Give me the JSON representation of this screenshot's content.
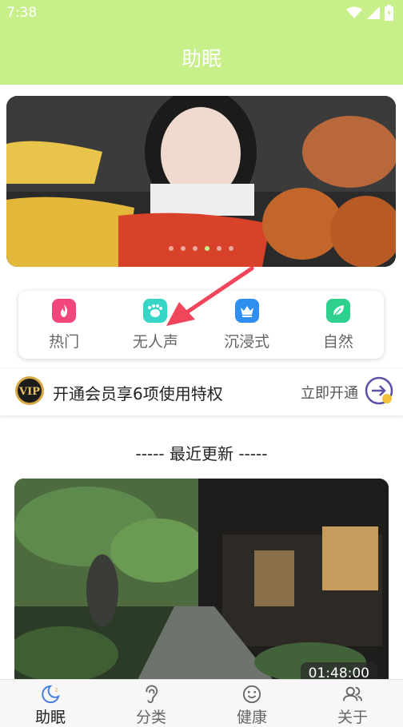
{
  "status": {
    "time": "7:38"
  },
  "app": {
    "title": "助眠"
  },
  "banner": {
    "dots": 6,
    "active_dot": 3
  },
  "categories": [
    {
      "label": "热门",
      "icon": "flame-icon",
      "color": "#f2477a"
    },
    {
      "label": "无人声",
      "icon": "footprint-icon",
      "color": "#35d6c8"
    },
    {
      "label": "沉浸式",
      "icon": "crown-icon",
      "color": "#2f8ff0"
    },
    {
      "label": "自然",
      "icon": "leaf-icon",
      "color": "#2fd08e"
    }
  ],
  "vip": {
    "text": "开通会员享6项使用特权",
    "action": "立即开通",
    "badge": "VIP"
  },
  "section": {
    "title": "-----  最近更新  -----"
  },
  "video": {
    "duration": "01:48:00"
  },
  "nav": [
    {
      "label": "助眠",
      "icon": "moon-sleep-icon",
      "active": true
    },
    {
      "label": "分类",
      "icon": "ear-icon",
      "active": false
    },
    {
      "label": "健康",
      "icon": "smile-icon",
      "active": false
    },
    {
      "label": "关于",
      "icon": "users-icon",
      "active": false
    }
  ],
  "colors": {
    "accent": "#c8f08a",
    "annotation": "#f0455a"
  }
}
